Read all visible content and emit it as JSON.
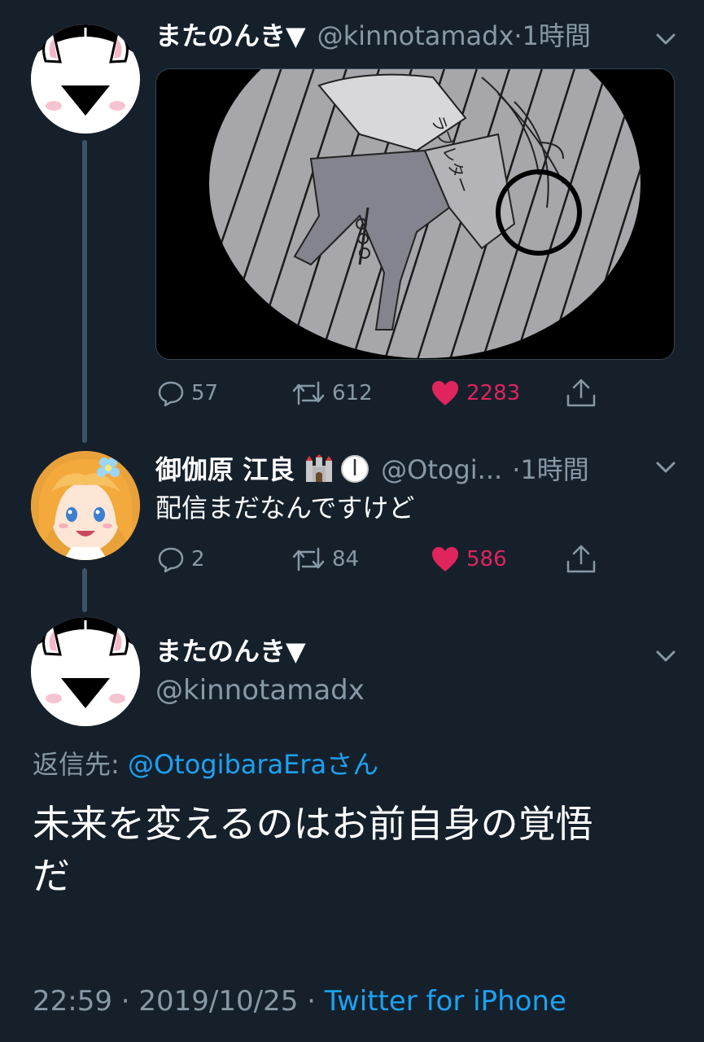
{
  "thread": [
    {
      "author": {
        "display_name": "またのんき▼",
        "handle": "@kinnotamadx"
      },
      "time": "1時間",
      "actions": {
        "replies": "57",
        "retweets": "612",
        "likes": "2283"
      },
      "media": {
        "shirt_text": "ラブレター"
      }
    },
    {
      "author": {
        "display_name": "御伽原 江良",
        "handle": "@Otogi..."
      },
      "time": "1時間",
      "text": "配信まだなんですけど",
      "actions": {
        "replies": "2",
        "retweets": "84",
        "likes": "586"
      }
    }
  ],
  "focused": {
    "author": {
      "display_name": "またのんき▼",
      "handle": "@kinnotamadx"
    },
    "reply_label": "返信先:",
    "reply_handle": "@OtogibaraEraさん",
    "text_line1": "未来を変えるのはお前自身の覚悟",
    "text_line2": "だ",
    "timestamp": "22:59 · 2019/10/25 · ",
    "source": "Twitter for iPhone"
  },
  "colors": {
    "background": "#15202b",
    "secondary_text": "#8899a6",
    "link": "#1da1f2",
    "like": "#e0245e"
  }
}
